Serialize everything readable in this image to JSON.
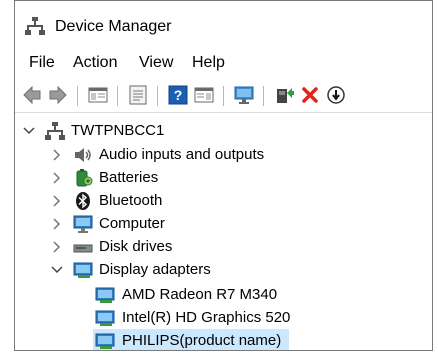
{
  "window": {
    "title": "Device Manager",
    "icon": "device-manager-icon"
  },
  "menu": [
    {
      "label": "File"
    },
    {
      "label": "Action"
    },
    {
      "label": "View"
    },
    {
      "label": "Help"
    }
  ],
  "toolbar": [
    {
      "name": "back-arrow-icon"
    },
    {
      "name": "forward-arrow-icon"
    },
    {
      "name": "show-hide-console-tree-icon"
    },
    {
      "name": "properties-icon"
    },
    {
      "name": "help-icon"
    },
    {
      "name": "action-pane-icon"
    },
    {
      "name": "scan-hardware-changes-icon"
    },
    {
      "name": "update-driver-icon"
    },
    {
      "name": "uninstall-device-icon",
      "color": "#e2231a"
    },
    {
      "name": "disable-device-icon"
    }
  ],
  "tree": {
    "root": {
      "label": "TWTPNBCC1",
      "icon": "computer-tree-icon",
      "expanded": true
    },
    "categories": [
      {
        "label": "Audio inputs and outputs",
        "icon": "speaker-icon",
        "expanded": false
      },
      {
        "label": "Batteries",
        "icon": "battery-icon",
        "expanded": false
      },
      {
        "label": "Bluetooth",
        "icon": "bluetooth-icon",
        "expanded": false
      },
      {
        "label": "Computer",
        "icon": "monitor-icon",
        "expanded": false
      },
      {
        "label": "Disk drives",
        "icon": "disk-drive-icon",
        "expanded": false
      },
      {
        "label": "Display adapters",
        "icon": "display-adapter-icon",
        "expanded": true,
        "children": [
          {
            "label": "AMD Radeon R7 M340",
            "icon": "display-adapter-icon"
          },
          {
            "label": "Intel(R) HD Graphics 520",
            "icon": "display-adapter-icon"
          },
          {
            "label": "PHILIPS(product name)",
            "icon": "display-adapter-icon",
            "selected": true
          }
        ]
      }
    ]
  },
  "colors": {
    "selection": "#cce8ff",
    "accent": "#1a6dc7",
    "delete": "#e2231a"
  }
}
